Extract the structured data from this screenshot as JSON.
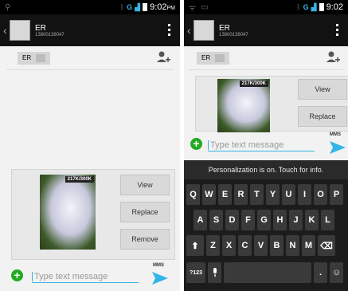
{
  "left": {
    "status": {
      "time": "9:02",
      "time_suffix": "PM",
      "network": "G"
    },
    "header": {
      "name": "ER",
      "number": "13800138047"
    },
    "recipient_chip": "ER",
    "attachment": {
      "size": "217K/300K",
      "buttons": [
        "View",
        "Replace",
        "Remove"
      ]
    },
    "compose": {
      "placeholder": "Type text message",
      "mode": "MMS"
    }
  },
  "right": {
    "status": {
      "time": "9:02",
      "network": "G"
    },
    "header": {
      "name": "ER",
      "number": "13800138047"
    },
    "recipient_chip": "ER",
    "attachment": {
      "size": "217K/300K",
      "buttons": [
        "View",
        "Replace"
      ]
    },
    "compose": {
      "placeholder": "Type text message",
      "mode": "MMS"
    },
    "keyboard": {
      "banner": "Personalization is on. Touch for info.",
      "row1": [
        "Q",
        "W",
        "E",
        "R",
        "T",
        "Y",
        "U",
        "I",
        "O",
        "P"
      ],
      "row2": [
        "A",
        "S",
        "D",
        "F",
        "G",
        "H",
        "J",
        "K",
        "L"
      ],
      "row3": [
        "Z",
        "X",
        "C",
        "V",
        "B",
        "N",
        "M"
      ],
      "numbers_key": "?123",
      "period_key": "."
    }
  },
  "colors": {
    "accent": "#33b5e5",
    "add": "#22aa22",
    "actionbar": "#121212",
    "statusbar": "#000000"
  }
}
